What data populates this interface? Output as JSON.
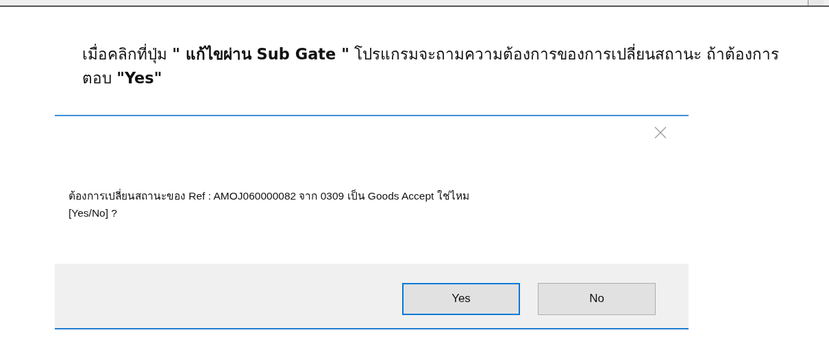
{
  "instruction": "เมื่อคลิกที่ปุ่ม **\" แก้ไขผ่าน Sub Gate \"** โปรแกรมจะถามความต้องการของการเปลี่ยนสถานะ ถ้าต้องการตอบ **\"Yes\"**",
  "dialog": {
    "message": "ต้องการเปลี่ยนสถานะของ Ref : AMOJ060000082 จาก 0309 เป็น Goods Accept ใช่ไหม [Yes/No] ?",
    "buttons": [
      {
        "label": "Yes",
        "default": true
      },
      {
        "label": "No",
        "default": false
      }
    ]
  }
}
